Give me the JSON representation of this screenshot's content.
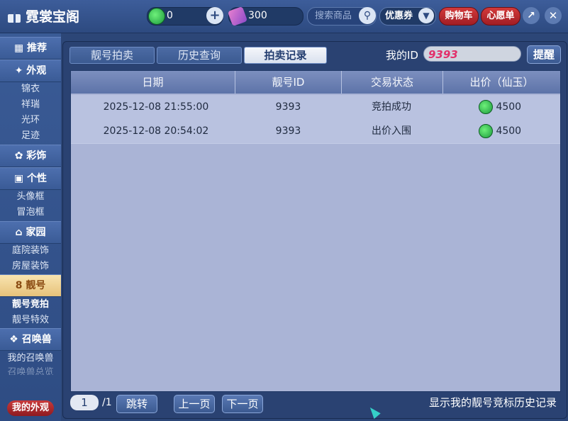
{
  "app": {
    "title": "霓裳宝阁"
  },
  "header": {
    "currency_green": "0",
    "currency_ticket": "300",
    "search_placeholder": "搜索商品",
    "coupon_label": "优惠券",
    "cart_label": "购物车",
    "wishlist_label": "心愿单"
  },
  "sidebar": {
    "items": [
      {
        "label": "推荐",
        "type": "category"
      },
      {
        "label": "外观",
        "type": "category"
      },
      {
        "label": "锦衣",
        "type": "sub"
      },
      {
        "label": "祥瑞",
        "type": "sub"
      },
      {
        "label": "光环",
        "type": "sub"
      },
      {
        "label": "足迹",
        "type": "sub"
      },
      {
        "label": "彩饰",
        "type": "category"
      },
      {
        "label": "个性",
        "type": "category"
      },
      {
        "label": "头像框",
        "type": "sub"
      },
      {
        "label": "冒泡框",
        "type": "sub"
      },
      {
        "label": "家园",
        "type": "category"
      },
      {
        "label": "庭院装饰",
        "type": "sub"
      },
      {
        "label": "房屋装饰",
        "type": "sub"
      },
      {
        "label": "靓号",
        "type": "category",
        "active": true
      },
      {
        "label": "靓号竞拍",
        "type": "sub",
        "active": true
      },
      {
        "label": "靓号特效",
        "type": "sub"
      },
      {
        "label": "召唤兽",
        "type": "category"
      },
      {
        "label": "我的召唤兽",
        "type": "sub"
      },
      {
        "label": "召唤兽总览",
        "type": "sub"
      }
    ],
    "my_outfit_label": "我的外观"
  },
  "tabs": [
    {
      "label": "靓号拍卖"
    },
    {
      "label": "历史查询"
    },
    {
      "label": "拍卖记录",
      "active": true
    }
  ],
  "my_id": {
    "label": "我的ID",
    "value": "9393"
  },
  "remind_label": "提醒",
  "table": {
    "columns": [
      "日期",
      "靓号ID",
      "交易状态",
      "出价（仙玉）"
    ],
    "rows": [
      {
        "date": "2025-12-08 21:55:00",
        "id": "9393",
        "status": "竞拍成功",
        "price": "4500"
      },
      {
        "date": "2025-12-08 20:54:02",
        "id": "9393",
        "status": "出价入围",
        "price": "4500"
      }
    ]
  },
  "pagination": {
    "current": "1",
    "total": "/1",
    "jump_label": "跳转",
    "prev_label": "上一页",
    "next_label": "下一页"
  },
  "footer_note": "显示我的靓号竞标历史记录",
  "colors": {
    "accent_red": "#c93a3a",
    "panel_bg": "#2a4272",
    "table_bg": "#aab4d6"
  }
}
